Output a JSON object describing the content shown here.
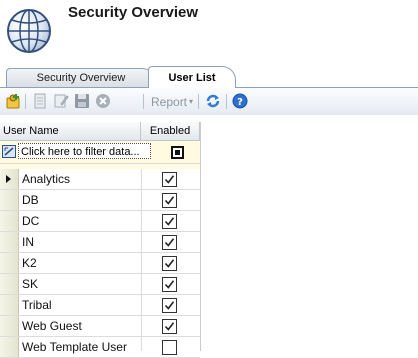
{
  "header": {
    "title": "Security Overview"
  },
  "tabs": [
    {
      "label": "Security Overview",
      "active": false
    },
    {
      "label": "User List",
      "active": true
    }
  ],
  "toolbar": {
    "report_label": "Report",
    "icons": [
      "add-user-icon",
      "properties-icon",
      "edit-icon",
      "save-icon",
      "delete-icon",
      "report-icon",
      "refresh-icon",
      "help-icon"
    ]
  },
  "grid": {
    "columns": [
      "User Name",
      "Enabled"
    ],
    "filter_placeholder": "Click here to filter data...",
    "rows": [
      {
        "name": "Analytics",
        "enabled": true,
        "current": true
      },
      {
        "name": "DB",
        "enabled": true,
        "current": false
      },
      {
        "name": "DC",
        "enabled": true,
        "current": false
      },
      {
        "name": "IN",
        "enabled": true,
        "current": false
      },
      {
        "name": "K2",
        "enabled": true,
        "current": false
      },
      {
        "name": "SK",
        "enabled": true,
        "current": false
      },
      {
        "name": "Tribal",
        "enabled": true,
        "current": false
      },
      {
        "name": "Web Guest",
        "enabled": true,
        "current": false
      },
      {
        "name": "Web Template User",
        "enabled": false,
        "current": false
      }
    ]
  },
  "colors": {
    "tab_border": "#8aa2bd",
    "filter_row": "#fffae0",
    "row_header": "#e3e4cf"
  }
}
